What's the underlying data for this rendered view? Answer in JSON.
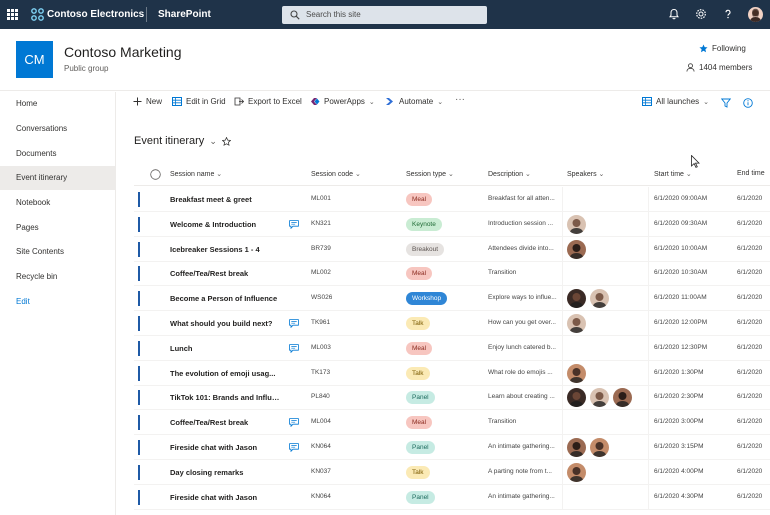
{
  "suite": {
    "brand": "Contoso Electronics",
    "app": "SharePoint",
    "search_placeholder": "Search this site"
  },
  "site": {
    "logo": "CM",
    "title": "Contoso Marketing",
    "subtitle": "Public group",
    "following": "Following",
    "members": "1404 members"
  },
  "nav": {
    "items": [
      "Home",
      "Conversations",
      "Documents",
      "Event itinerary",
      "Notebook",
      "Pages",
      "Site Contents",
      "Recycle bin",
      "Edit"
    ],
    "active": "Event itinerary"
  },
  "commands": {
    "new": "New",
    "edit_grid": "Edit in Grid",
    "export": "Export to Excel",
    "powerapps": "PowerApps",
    "automate": "Automate",
    "view": "All launches"
  },
  "list": {
    "title": "Event itinerary",
    "columns": [
      "Session name",
      "Session code",
      "Session type",
      "Description",
      "Speakers",
      "Start time",
      "End time"
    ],
    "rows": [
      {
        "name": "Breakfast meet & greet",
        "code": "ML001",
        "type": "Meal",
        "desc": "Breakfast for all atten...",
        "speakers": 0,
        "comment": false,
        "start": "6/1/2020 09:00AM",
        "end": "6/1/2020"
      },
      {
        "name": "Welcome & Introduction",
        "code": "KN321",
        "type": "Keynote",
        "desc": "Introduction session ...",
        "speakers": 1,
        "comment": true,
        "start": "6/1/2020 09:30AM",
        "end": "6/1/2020"
      },
      {
        "name": "Icebreaker Sessions 1 - 4",
        "code": "BR739",
        "type": "Breakout",
        "desc": "Attendees divide into...",
        "speakers": 1,
        "comment": false,
        "start": "6/1/2020 10:00AM",
        "end": "6/1/2020"
      },
      {
        "name": "Coffee/Tea/Rest break",
        "code": "ML002",
        "type": "Meal",
        "desc": "Transition",
        "speakers": 0,
        "comment": false,
        "start": "6/1/2020 10:30AM",
        "end": "6/1/2020"
      },
      {
        "name": "Become a Person of Influence",
        "code": "WS026",
        "type": "Workshop",
        "desc": "Explore ways to influe...",
        "speakers": 2,
        "comment": false,
        "start": "6/1/2020 11:00AM",
        "end": "6/1/2020"
      },
      {
        "name": "What should you build next?",
        "code": "TK961",
        "type": "Talk",
        "desc": "How can you get over...",
        "speakers": 1,
        "comment": true,
        "start": "6/1/2020 12:00PM",
        "end": "6/1/2020"
      },
      {
        "name": "Lunch",
        "code": "ML003",
        "type": "Meal",
        "desc": "Enjoy lunch catered b...",
        "speakers": 0,
        "comment": true,
        "start": "6/1/2020 12:30PM",
        "end": "6/1/2020"
      },
      {
        "name": "The evolution of emoji usag...",
        "code": "TK173",
        "type": "Talk",
        "desc": "What role do emojis ...",
        "speakers": 1,
        "comment": false,
        "start": "6/1/2020 1:30PM",
        "end": "6/1/2020"
      },
      {
        "name": "TikTok 101: Brands and Influe...",
        "code": "PL840",
        "type": "Panel",
        "desc": "Learn about creating ...",
        "speakers": 3,
        "comment": false,
        "start": "6/1/2020 2:30PM",
        "end": "6/1/2020"
      },
      {
        "name": "Coffee/Tea/Rest break",
        "code": "ML004",
        "type": "Meal",
        "desc": "Transition",
        "speakers": 0,
        "comment": true,
        "start": "6/1/2020 3:00PM",
        "end": "6/1/2020"
      },
      {
        "name": "Fireside chat with Jason",
        "code": "KN064",
        "type": "Panel",
        "desc": "An intimate gathering...",
        "speakers": 2,
        "comment": true,
        "start": "6/1/2020 3:15PM",
        "end": "6/1/2020"
      },
      {
        "name": "Day closing remarks",
        "code": "KN037",
        "type": "Talk",
        "desc": "A parting note from t...",
        "speakers": 1,
        "comment": false,
        "start": "6/1/2020 4:00PM",
        "end": "6/1/2020"
      },
      {
        "name": "Fireside chat with Jason",
        "code": "KN064",
        "type": "Panel",
        "desc": "An intimate gathering...",
        "speakers": 0,
        "comment": false,
        "start": "6/1/2020 4:30PM",
        "end": "6/1/2020"
      }
    ]
  },
  "pill_colors": {
    "Meal": {
      "bg": "#f7c6c0",
      "fg": "#8a2a1f"
    },
    "Keynote": {
      "bg": "#c9ecd3",
      "fg": "#1f6b35"
    },
    "Breakout": {
      "bg": "#e6e3e1",
      "fg": "#5b5350"
    },
    "Workshop": {
      "bg": "#2f86d6",
      "fg": "#ffffff"
    },
    "Talk": {
      "bg": "#fbeab5",
      "fg": "#7a5a00"
    },
    "Panel": {
      "bg": "#c6ebe3",
      "fg": "#1d6b5e"
    }
  },
  "colors": {
    "suitebar": "#1f3349",
    "accent": "#0078d4"
  }
}
